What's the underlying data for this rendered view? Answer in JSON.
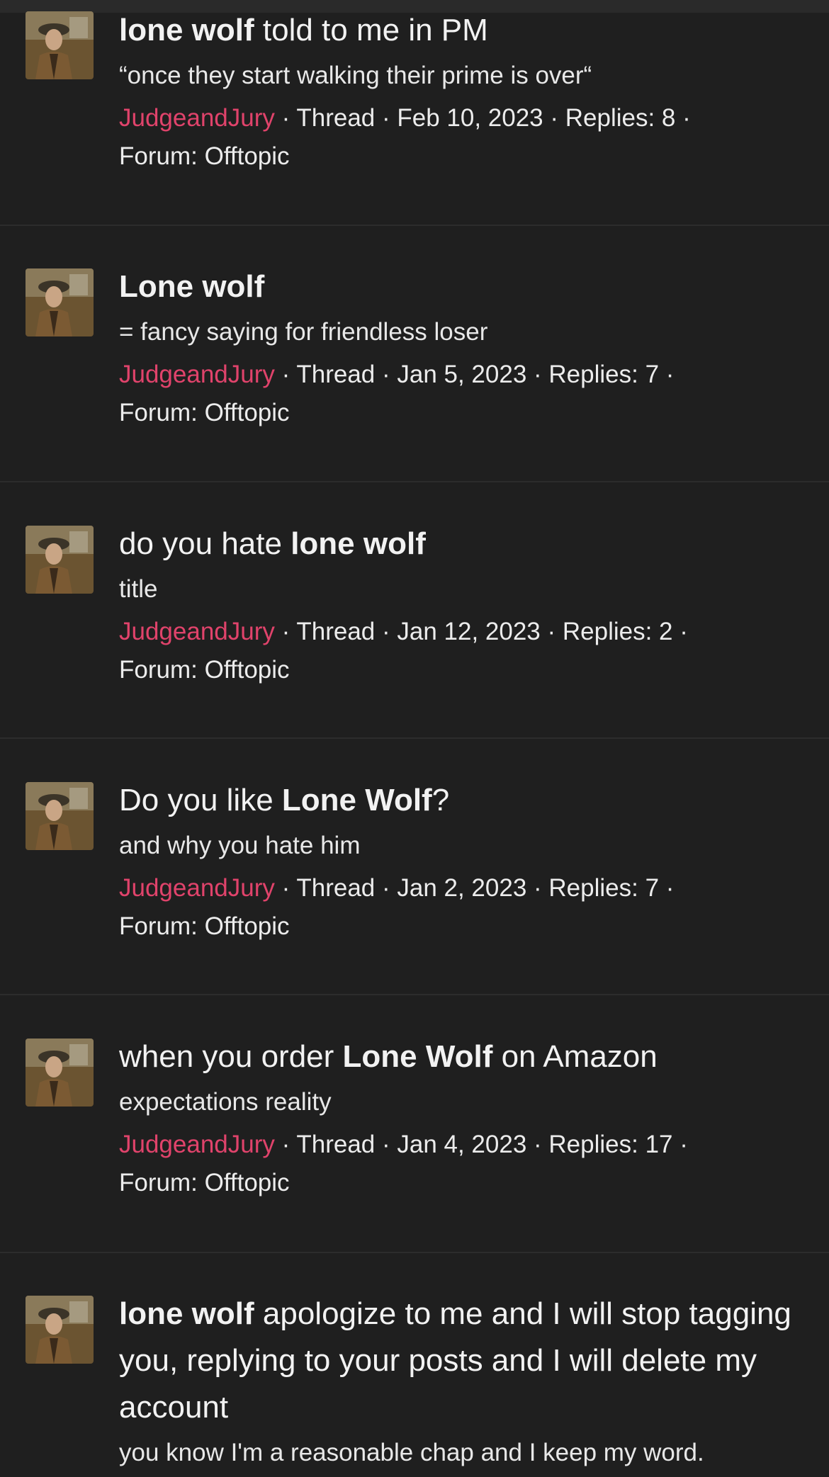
{
  "results": [
    {
      "title_parts": [
        {
          "text": "lone wolf",
          "bold": true
        },
        {
          "text": " told to me in PM",
          "bold": false
        }
      ],
      "snippet": "“once they start walking their prime is over“",
      "author": "JudgeandJury",
      "meta_rest": " · Thread · Feb 10, 2023 · Replies: 8 ·",
      "forum": "Forum: Offtopic"
    },
    {
      "title_parts": [
        {
          "text": "Lone wolf",
          "bold": true
        }
      ],
      "snippet": "= fancy saying for friendless loser",
      "author": "JudgeandJury",
      "meta_rest": " · Thread · Jan 5, 2023 · Replies: 7 ·",
      "forum": "Forum: Offtopic"
    },
    {
      "title_parts": [
        {
          "text": "do you hate ",
          "bold": false
        },
        {
          "text": "lone wolf",
          "bold": true
        }
      ],
      "snippet": "title",
      "author": "JudgeandJury",
      "meta_rest": " · Thread · Jan 12, 2023 · Replies: 2 ·",
      "forum": "Forum: Offtopic"
    },
    {
      "title_parts": [
        {
          "text": "Do you like ",
          "bold": false
        },
        {
          "text": "Lone Wolf",
          "bold": true
        },
        {
          "text": "?",
          "bold": false
        }
      ],
      "snippet": "and why you hate him",
      "author": "JudgeandJury",
      "meta_rest": " · Thread · Jan 2, 2023 · Replies: 7 ·",
      "forum": "Forum: Offtopic"
    },
    {
      "title_parts": [
        {
          "text": "when you order ",
          "bold": false
        },
        {
          "text": "Lone Wolf",
          "bold": true
        },
        {
          "text": " on Amazon",
          "bold": false
        }
      ],
      "snippet": "expectations reality",
      "author": "JudgeandJury",
      "meta_rest": " · Thread · Jan 4, 2023 · Replies: 17 ·",
      "forum": "Forum: Offtopic"
    },
    {
      "title_parts": [
        {
          "text": "lone wolf",
          "bold": true
        },
        {
          "text": " apologize to me and I will stop tagging you, replying to your posts and I will delete my account",
          "bold": false
        }
      ],
      "snippet": "you know I'm a reasonable chap and I keep my word.",
      "author": "",
      "meta_rest": "",
      "forum": ""
    }
  ],
  "colors": {
    "background": "#1f1f1f",
    "author_link": "#e0436b",
    "divider": "#2c2c2c"
  },
  "icons": {
    "avatar": "user-avatar-photo"
  }
}
